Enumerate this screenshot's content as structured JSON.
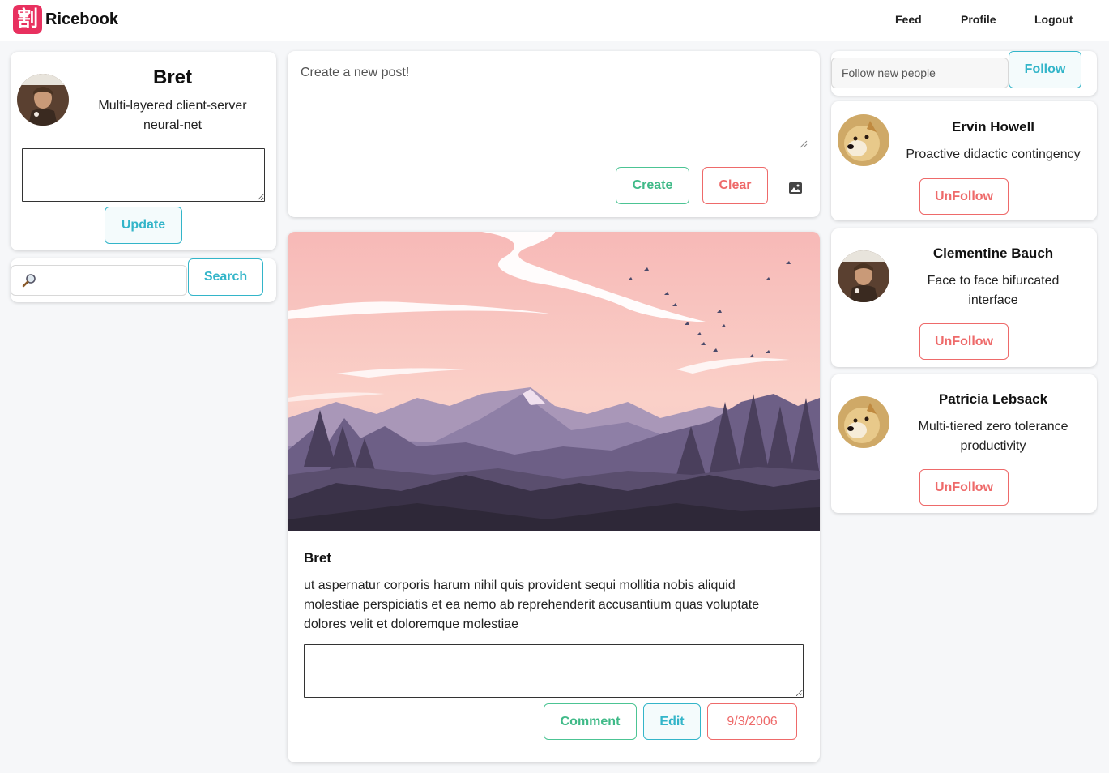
{
  "nav": {
    "logo_glyph": "割",
    "brand": "Ricebook",
    "links": [
      "Feed",
      "Profile",
      "Logout"
    ]
  },
  "profile": {
    "name": "Bret",
    "headline": "Multi-layered client-server neural-net",
    "status_value": "",
    "update_label": "Update"
  },
  "search": {
    "value": "",
    "button_label": "Search"
  },
  "new_post": {
    "placeholder": "Create a new post!",
    "create_label": "Create",
    "clear_label": "Clear",
    "image_icon": "image-icon"
  },
  "post": {
    "author": "Bret",
    "body": "ut aspernatur corporis harum nihil quis provident sequi mollitia nobis aliquid molestiae perspiciatis et ea nemo ab reprehenderit accusantium quas voluptate dolores velit et doloremque molestiae",
    "comment_value": "",
    "comment_label": "Comment",
    "edit_label": "Edit",
    "date": "9/3/2006"
  },
  "follow": {
    "placeholder": "Follow new people",
    "button_label": "Follow"
  },
  "following": [
    {
      "name": "Ervin Howell",
      "headline": "Proactive didactic contingency",
      "button_label": "UnFollow"
    },
    {
      "name": "Clementine Bauch",
      "headline": "Face to face bifurcated interface",
      "button_label": "UnFollow"
    },
    {
      "name": "Patricia Lebsack",
      "headline": "Multi-tiered zero tolerance productivity",
      "button_label": "UnFollow"
    }
  ],
  "colors": {
    "accent_teal": "#33b5c9",
    "accent_green": "#40ba88",
    "accent_red": "#ee6a6a",
    "logo_pink": "#e8305f"
  }
}
